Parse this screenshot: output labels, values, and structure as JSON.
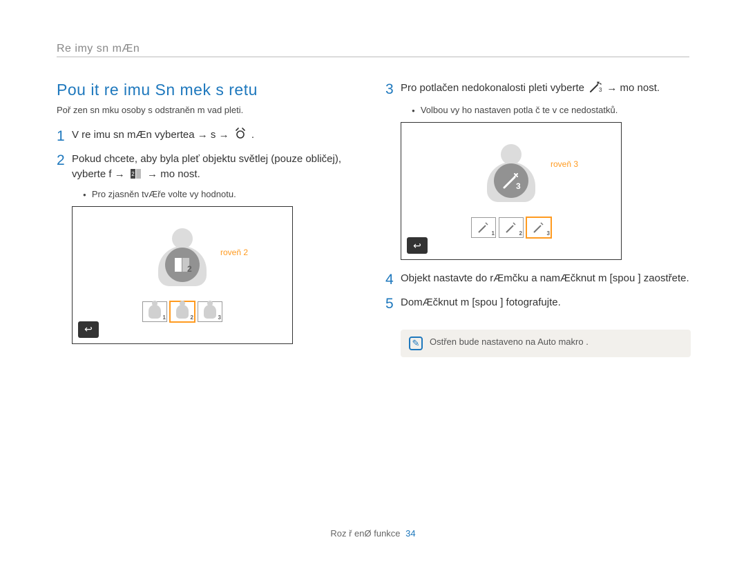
{
  "breadcrumb": "Re imy sn mÆn",
  "section_title": "Pou it  re imu Sn mek s retu",
  "subtitle": "Poř zen  sn mku osoby s odstraněn m vad pleti.",
  "steps": {
    "s1_num": "1",
    "s1_a": "V re imu sn mÆn  vybertea  → s  →",
    "s1_end": ".",
    "s2_num": "2",
    "s2_a": "Pokud chcete, aby byla pleť objektu světlej   (pouze obličej), vyberte f    →",
    "s2_b": "→ mo nost.",
    "s2_sub": "Pro zjasněn  tvÆře volte vy    hodnotu.",
    "s3_num": "3",
    "s3_a": "Pro potlačen  nedokonalosti pleti vyberte",
    "s3_b": "→ mo nost.",
    "s3_sub": "Volbou vy   ho nastaven  potla č te v ce nedostatků.",
    "s4_num": "4",
    "s4": "Objekt nastavte do rÆmčku a namÆčknut m [spou   ] zaostřete.",
    "s5_num": "5",
    "s5": "DomÆčknut m [spou   ] fotografujte."
  },
  "preview": {
    "level_label_left": "roveň  2",
    "level_label_right": "roveň  3",
    "thumb_sub_1": "1",
    "thumb_sub_2": "2",
    "thumb_sub_3": "3",
    "back": "↩"
  },
  "note": {
    "text": "Ostřen  bude nastaveno na Auto makro ."
  },
  "footer": {
    "text": "Roz  ř enØ funkce",
    "page": "34"
  }
}
